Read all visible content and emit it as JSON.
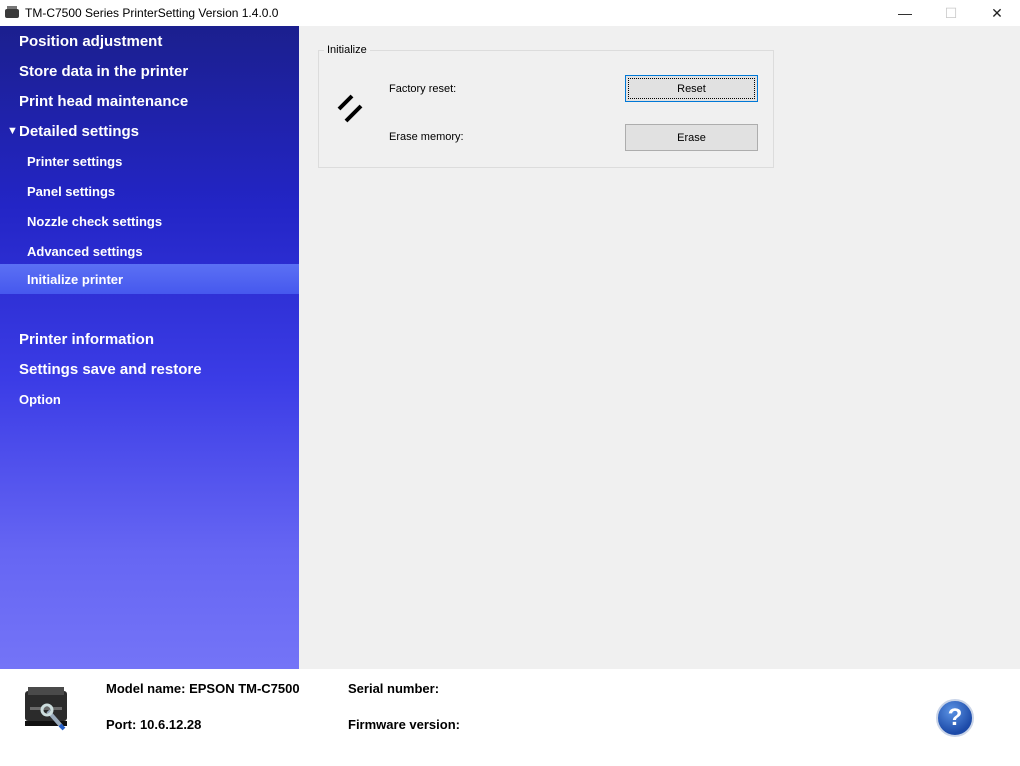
{
  "window": {
    "title": "TM-C7500 Series PrinterSetting Version 1.4.0.0",
    "minimize_glyph": "—",
    "maximize_glyph": "☐",
    "close_glyph": "✕"
  },
  "sidebar": {
    "collapse_glyph": "▼",
    "items": [
      {
        "label": "Position adjustment"
      },
      {
        "label": "Store data in the printer"
      },
      {
        "label": "Print head maintenance"
      },
      {
        "label": "Detailed settings"
      },
      {
        "label": "Printer settings"
      },
      {
        "label": "Panel settings"
      },
      {
        "label": "Nozzle check settings"
      },
      {
        "label": "Advanced settings"
      },
      {
        "label": "Initialize printer"
      },
      {
        "label": "Printer information"
      },
      {
        "label": "Settings save and restore"
      },
      {
        "label": "Option"
      }
    ],
    "selected": "Initialize printer"
  },
  "initialize": {
    "group_title": "Initialize",
    "factory_reset_label": "Factory reset:",
    "reset_button": "Reset",
    "erase_memory_label": "Erase memory:",
    "erase_button": "Erase"
  },
  "footer": {
    "model_name": "Model name: EPSON TM-C7500",
    "port": "Port: 10.6.12.28",
    "serial_number": "Serial number:",
    "firmware_version": "Firmware version:",
    "help_glyph": "?"
  },
  "colors": {
    "sidebar_top": "#1b1f8e",
    "sidebar_bottom": "#7474f7",
    "selected_item": "#4c5ff0",
    "content_bg": "#f0f0f0",
    "button_bg": "#e1e1e1"
  }
}
